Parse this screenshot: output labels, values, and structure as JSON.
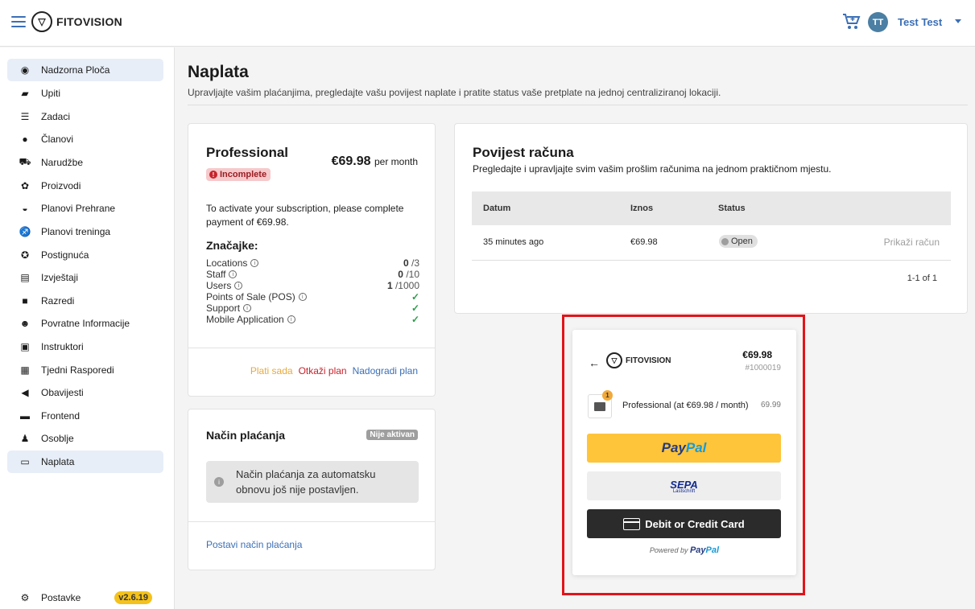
{
  "app": {
    "name": "FITOVISION",
    "user_initials": "TT",
    "user_name": "Test Test"
  },
  "sidebar": {
    "items": [
      {
        "label": "Nadzorna Ploča",
        "icon": "dashboard-icon",
        "active": true
      },
      {
        "label": "Upiti",
        "icon": "chat-icon"
      },
      {
        "label": "Zadaci",
        "icon": "tasks-icon"
      },
      {
        "label": "Članovi",
        "icon": "members-icon"
      },
      {
        "label": "Narudžbe",
        "icon": "cart-icon"
      },
      {
        "label": "Proizvodi",
        "icon": "products-icon"
      },
      {
        "label": "Planovi Prehrane",
        "icon": "food-icon"
      },
      {
        "label": "Planovi treninga",
        "icon": "run-icon"
      },
      {
        "label": "Postignuća",
        "icon": "award-icon"
      },
      {
        "label": "Izvještaji",
        "icon": "report-icon"
      },
      {
        "label": "Razredi",
        "icon": "class-icon"
      },
      {
        "label": "Povratne Informacije",
        "icon": "feedback-icon"
      },
      {
        "label": "Instruktori",
        "icon": "instructor-icon"
      },
      {
        "label": "Tjedni Rasporedi",
        "icon": "calendar-icon"
      },
      {
        "label": "Obavijesti",
        "icon": "megaphone-icon"
      },
      {
        "label": "Frontend",
        "icon": "frontend-icon"
      },
      {
        "label": "Osoblje",
        "icon": "staff-icon"
      },
      {
        "label": "Naplata",
        "icon": "credit-card-icon",
        "active": true
      }
    ],
    "settings_label": "Postavke",
    "version": "v2.6.19"
  },
  "page": {
    "title": "Naplata",
    "subtitle": "Upravljajte vašim plaćanjima, pregledajte vašu povijest naplate i pratite status vaše pretplate na jednoj centraliziranoj lokaciji."
  },
  "plan": {
    "name": "Professional",
    "price": "€69.98",
    "period": "per month",
    "status": "Incomplete",
    "message": "To activate your subscription, please complete payment of €69.98.",
    "features_title": "Značajke:",
    "features": [
      {
        "label": "Locations",
        "used": "0",
        "limit": " /3"
      },
      {
        "label": "Staff",
        "used": "0",
        "limit": " /10"
      },
      {
        "label": "Users",
        "used": "1",
        "limit": " /1000"
      },
      {
        "label": "Points of Sale (POS)",
        "check": true
      },
      {
        "label": "Support",
        "check": true
      },
      {
        "label": "Mobile Application",
        "check": true
      }
    ],
    "actions": {
      "pay": "Plati sada",
      "cancel": "Otkaži plan",
      "upgrade": "Nadogradi plan"
    }
  },
  "payment_method": {
    "title": "Način plaćanja",
    "badge": "Nije aktivan",
    "info": "Način plaćanja za automatsku obnovu još nije postavljen.",
    "link": "Postavi način plaćanja"
  },
  "history": {
    "title": "Povijest računa",
    "subtitle": "Pregledajte i upravljajte svim vašim prošlim računima na jednom praktičnom mjestu.",
    "columns": [
      "Datum",
      "Iznos",
      "Status"
    ],
    "rows": [
      {
        "date": "35 minutes ago",
        "amount": "€69.98",
        "status": "Open",
        "action": "Prikaži račun"
      }
    ],
    "pagination": "1-1 of 1"
  },
  "paypal": {
    "brand": "FITOVISION",
    "total": "€69.98",
    "invoice": "#1000019",
    "item_qty": "1",
    "item_name": "Professional (at €69.98 / month)",
    "item_price": "69.99",
    "paypal_p1": "Pay",
    "paypal_p2": "Pal",
    "sepa": "SEPA",
    "sepa_sub": "Lastschrift",
    "card_label": "Debit or Credit Card",
    "powered_by": "Powered by",
    "powered_p1": "Pay",
    "powered_p2": "Pal"
  },
  "colors": {
    "accent": "#3b6fb6",
    "highlight": "#e2131a",
    "paypal_yellow": "#fec43a"
  }
}
